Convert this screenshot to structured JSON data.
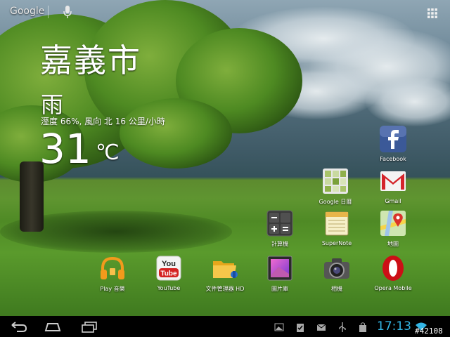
{
  "topbar": {
    "search_label": "Google",
    "mic_icon": "microphone-icon",
    "apps_icon": "app-drawer-grid-icon"
  },
  "weather": {
    "city": "嘉義市",
    "condition": "雨",
    "detail": "溼度 66%, 風向 北 16 公里/小時",
    "temperature": "31",
    "unit": "℃"
  },
  "apps": {
    "facebook": {
      "label": "Facebook",
      "icon": "facebook-icon"
    },
    "google_calendar": {
      "label": "Google 日曆",
      "icon": "calendar-icon"
    },
    "gmail": {
      "label": "Gmail",
      "icon": "gmail-icon"
    },
    "calculator": {
      "label": "計算機",
      "icon": "calculator-icon"
    },
    "supernote": {
      "label": "SuperNote",
      "icon": "notepad-icon"
    },
    "maps": {
      "label": "地圖",
      "icon": "maps-icon"
    },
    "play_music": {
      "label": "Play 音樂",
      "icon": "headphones-icon"
    },
    "youtube": {
      "label": "YouTube",
      "icon": "youtube-icon"
    },
    "file_manager": {
      "label": "文件管理器 HD",
      "icon": "folder-icon"
    },
    "gallery": {
      "label": "圖片庫",
      "icon": "gallery-icon"
    },
    "camera": {
      "label": "相機",
      "icon": "camera-icon"
    },
    "opera": {
      "label": "Opera Mobile",
      "icon": "opera-icon"
    }
  },
  "navbar": {
    "back_icon": "back-icon",
    "home_icon": "home-icon",
    "recents_icon": "recent-apps-icon",
    "status_icons": [
      "picture-notification-icon",
      "clipboard-check-icon",
      "mail-icon",
      "usb-icon",
      "shopping-bag-icon",
      "wifi-icon"
    ],
    "time": "17:13",
    "watermark": "#42108"
  },
  "colors": {
    "clock": "#33b5e5",
    "facebook": "#3b5998",
    "youtube_red": "#d42222",
    "opera_red": "#cc0f16"
  }
}
